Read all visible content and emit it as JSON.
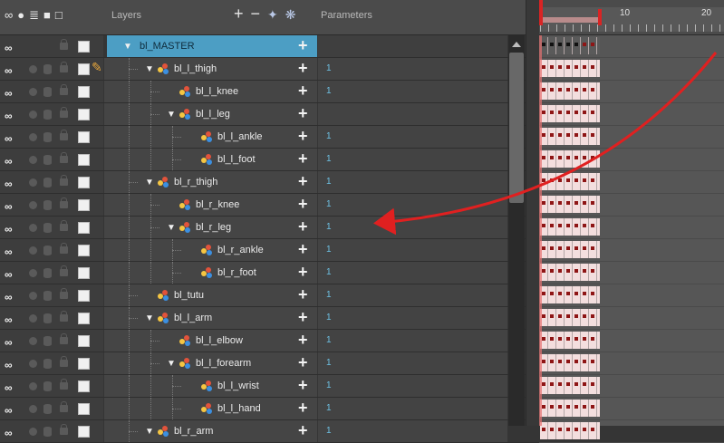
{
  "header": {
    "layers_label": "Layers",
    "parameters_label": "Parameters",
    "column_icons": [
      "oo-icon",
      "dot-icon",
      "database-icon",
      "lock-icon",
      "square-icon"
    ],
    "ruler": {
      "label_10": "10",
      "label_20": "20"
    }
  },
  "layers": [
    {
      "name": "bl_MASTER",
      "param": "",
      "master": true
    },
    {
      "name": "bl_l_thigh",
      "param": "1",
      "pen": true
    },
    {
      "name": "bl_l_knee",
      "param": "1"
    },
    {
      "name": "bl_l_leg",
      "param": ""
    },
    {
      "name": "bl_l_ankle",
      "param": "1"
    },
    {
      "name": "bl_l_foot",
      "param": "1"
    },
    {
      "name": "bl_r_thigh",
      "param": "1"
    },
    {
      "name": "bl_r_knee",
      "param": "1"
    },
    {
      "name": "bl_r_leg",
      "param": "1"
    },
    {
      "name": "bl_r_ankle",
      "param": "1"
    },
    {
      "name": "bl_r_foot",
      "param": "1"
    },
    {
      "name": "bl_tutu",
      "param": "1"
    },
    {
      "name": "bl_l_arm",
      "param": "1"
    },
    {
      "name": "bl_l_elbow",
      "param": "1"
    },
    {
      "name": "bl_l_forearm",
      "param": "1"
    },
    {
      "name": "bl_l_wrist",
      "param": "1"
    },
    {
      "name": "bl_l_hand",
      "param": "1"
    },
    {
      "name": "bl_r_arm",
      "param": "1"
    }
  ],
  "colors": {
    "accent": "#4c9ec4",
    "playhead": "#d92424",
    "annotation_arrow": "#e02020"
  }
}
